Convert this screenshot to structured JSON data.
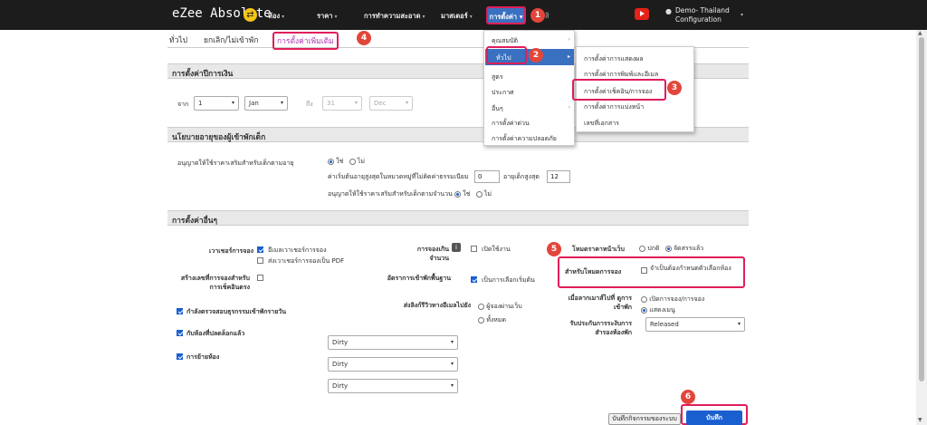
{
  "app": {
    "brand": "eZee Absolute",
    "brand_icon": "shuffle-icon"
  },
  "nav": {
    "items": [
      "ห้อง",
      "ราคา",
      "การทำความสะอาด",
      "มาสเตอร์"
    ],
    "active": "การตั้งค่า",
    "hidden_fragment": "สิ"
  },
  "user": {
    "name": "Demo- Thailand",
    "sub": "Configuration"
  },
  "subtabs": {
    "general": "ทั่วไป",
    "cancel_noshow": "ยกเลิก/ไม่เข้าพัก",
    "additional": "การตั้งค่าเพิ่มเติม"
  },
  "fiscal": {
    "title": "การตั้งค่าปีการเงิน",
    "from_label": "จาก",
    "to_label": "ถึง",
    "from_day": "1",
    "from_month": "Jan",
    "to_day": "31",
    "to_month": "Dec"
  },
  "child_policy": {
    "title": "นโยบายอายุของผู้เข้าพักเด็ก",
    "allow_extra_label": "อนุญาตให้ใช้ราคาเสริมสำหรับเด็กตามอายุ",
    "yes": "ใช่",
    "no": "ไม่",
    "max_age_line": "ค่าเริ่มต้นอายุสูงสุดในหมวดหมู่ที่ไม่คิดค่าธรรมเนียม",
    "max_age_value": "0",
    "child_max_label": "อายุเด็กสูงสุด",
    "child_max_value": "12",
    "allow_by_count_label": "อนุญาตให้ใช้ราคาเสริมสำหรับเด็กตามจำนวน"
  },
  "other": {
    "title": "การตั้งค่าอื่นๆ",
    "voucher_label": "เวาเชอร์การจอง",
    "voucher_email": "อีเมลเวาเชอร์การจอง",
    "voucher_pdf": "ส่งเวาเชอร์การจองเป็น PDF",
    "overbook_label": "การจองเกินจำนวน",
    "overbook_value": "เปิดใช้งาน",
    "website_label": "โหมดราคาหน้าเว็บ",
    "website_normal": "ปกติ",
    "website_discount": "จัดสรรแล้ว",
    "booking_no_label": "สร้างเลขที่การจองสำหรับการเช็คอินตรง",
    "checkin_rate_label": "อัตราการเข้าพักพื้นฐาน",
    "checkin_rate_value": "เป็นการเลือกเริ่มต้น",
    "reservation_mode_label": "สำหรับโหมดการจอง",
    "reservation_mode_value": "จำเป็นต้องกำหนดตัวเลือกห้อง",
    "audit_label": "กำลังตรวจสอบธุรกรรมเข้าพักรายวัน",
    "send_review_label": "ส่งลิงก์รีวิวทางอีเมลไปยัง",
    "send_review_guest": "ผู้จองผ่านเว็บ",
    "send_review_all": "ทั้งหมด",
    "checkout_label": "เมื่อลากเมาส์ไปที่ ดูการเข้าพัก",
    "checkout_opt1": "เปิดการจอง/การจอง",
    "checkout_opt2": "แสดงเมนู",
    "unlock_label": "กับห้องที่ปลดล็อกแล้ว",
    "room_move_label": "การย้ายห้อง",
    "receive_label": "รับประกันการระงับการสำรองห้องพัก",
    "receive_value": "Released",
    "dirty1": "Dirty",
    "dirty2": "Dirty",
    "dirty3": "Dirty"
  },
  "menu1": {
    "items": [
      "คุณสมบัติ",
      "ทั่วไป",
      "สูตร",
      "ประกาศ",
      "อื่นๆ",
      "การตั้งค่าด่วน",
      "การตั้งค่าความปลอดภัย"
    ]
  },
  "menu2": {
    "items": [
      "การตั้งค่าการแสดงผล",
      "การตั้งค่าการพิมพ์และอีเมล",
      "การตั้งค่าเช็คอิน/การจอง",
      "การตั้งค่าการแบ่งหน้า",
      "เลขที่เอกสาร"
    ]
  },
  "footer": {
    "audit_btn": "บันทึกกิจกรรมของระบบ",
    "save_btn": "บันทึก"
  },
  "markers": [
    "1",
    "2",
    "3",
    "4",
    "5",
    "6"
  ],
  "colors": {
    "accent": "#3a70c0",
    "highlight": "#e01e5a",
    "marker": "#e2463b",
    "topbar": "#1c1c1c"
  }
}
